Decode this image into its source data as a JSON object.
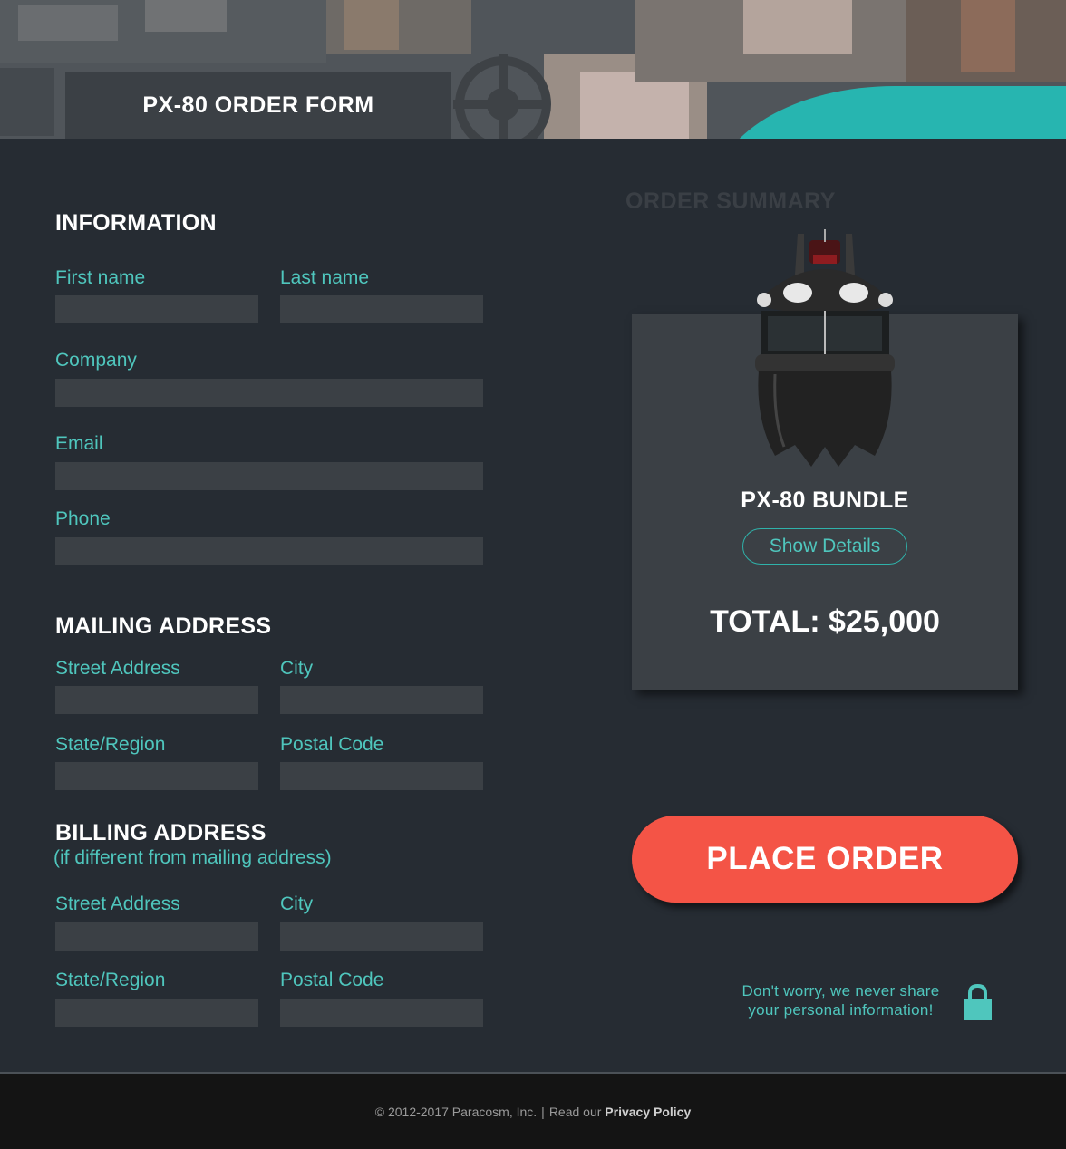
{
  "header": {
    "title": "PX-80 ORDER FORM"
  },
  "information": {
    "title": "INFORMATION",
    "first_name_label": "First name",
    "last_name_label": "Last name",
    "company_label": "Company",
    "email_label": "Email",
    "phone_label": "Phone"
  },
  "mailing": {
    "title": "MAILING ADDRESS",
    "street_label": "Street Address",
    "city_label": "City",
    "state_label": "State/Region",
    "postal_label": "Postal Code"
  },
  "billing": {
    "title": "BILLING ADDRESS",
    "subtitle": "(if different from mailing address)",
    "street_label": "Street Address",
    "city_label": "City",
    "state_label": "State/Region",
    "postal_label": "Postal Code"
  },
  "summary": {
    "heading": "ORDER SUMMARY",
    "product_name": "PX-80 BUNDLE",
    "details_button": "Show Details",
    "total": "TOTAL: $25,000"
  },
  "actions": {
    "place_order": "PLACE ORDER"
  },
  "privacy": {
    "line1": "Don't worry, we never share",
    "line2": "your personal information!"
  },
  "footer": {
    "copyright": "© 2012-2017 Paracosm, Inc.",
    "separator": "|",
    "read_our": "Read our",
    "privacy_link": "Privacy Policy"
  },
  "colors": {
    "background": "#262c33",
    "field": "#3b4045",
    "accent_teal": "#4fc6bd",
    "button_red": "#f45446",
    "footer": "#141414"
  },
  "icons": [
    "lock-icon",
    "product-image"
  ]
}
